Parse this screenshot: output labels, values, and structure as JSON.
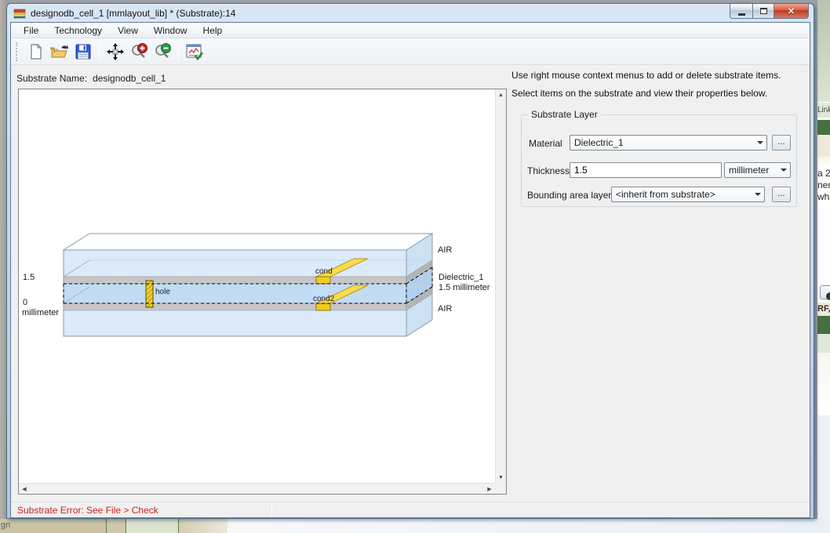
{
  "window": {
    "title": "designodb_cell_1 [mmlayout_lib] * (Substrate):14"
  },
  "menu": {
    "items": [
      "File",
      "Technology",
      "View",
      "Window",
      "Help"
    ]
  },
  "toolbar": {
    "icons": [
      "new-document",
      "open-folder",
      "save",
      "fit-view",
      "zoom-in",
      "zoom-out",
      "substrate-check"
    ]
  },
  "substrate_name": {
    "label": "Substrate Name:",
    "value": "designodb_cell_1"
  },
  "hints": {
    "line1": "Use right mouse context menus to add or delete substrate items.",
    "line2": "Select items on the substrate and view their properties below."
  },
  "substrate_layer": {
    "group_title": "Substrate Layer",
    "material_label": "Material",
    "material_value": "Dielectric_1",
    "browse_label": "...",
    "thickness_label": "Thickness",
    "thickness_value": "1.5",
    "thickness_unit": "millimeter",
    "bounding_label": "Bounding area layer:",
    "bounding_value": "<inherit from substrate>"
  },
  "diagram": {
    "axis_top": "1.5",
    "axis_zero": "0",
    "axis_unit": "millimeter",
    "label_air_top": "AIR",
    "label_dielectric": "Dielectric_1",
    "label_dielectric_thickness": "1.5 millimeter",
    "label_air_bottom": "AIR",
    "label_cond": "cond",
    "label_cond2": "cond2",
    "label_hole": "hole",
    "colors": {
      "air": "#dceafa",
      "dielectric": "#c2dcf6",
      "interface": "#c6c6c6",
      "conductor": "#f2d226",
      "top_face": "#fbfdff",
      "side_air": "#cde1f5",
      "side_dielectric": "#b2d0ee"
    }
  },
  "status": {
    "message": "Substrate Error: See File > Check"
  },
  "background_fragments": {
    "linkb": "LinkB",
    "line_a2": "a 2",
    "line_hem": "nem",
    "line_whe": "whe",
    "rf": "RF, N",
    "gn": "gn"
  }
}
